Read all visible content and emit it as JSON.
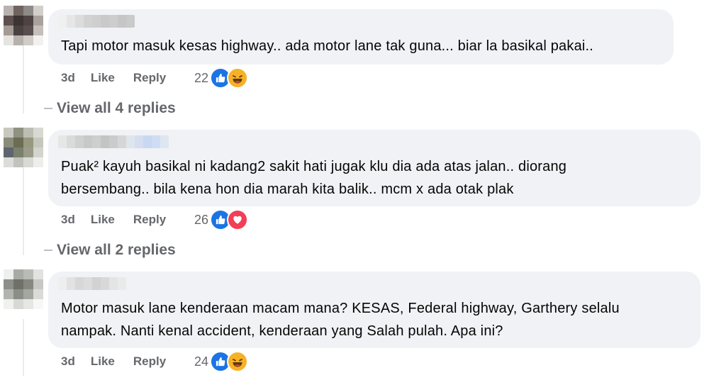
{
  "comments": [
    {
      "lines": [
        "Tapi motor masuk kesas highway.. ada motor lane tak guna... biar la basikal pakai.."
      ],
      "time": "3d",
      "like_label": "Like",
      "reply_label": "Reply",
      "reaction_count": "22",
      "reactions": [
        "like-icon",
        "haha-icon"
      ],
      "view_replies": "View all 4 replies"
    },
    {
      "lines": [
        "Puak² kayuh basikal ni kadang2 sakit hati jugak klu dia ada atas jalan.. diorang",
        "bersembang.. bila kena hon dia marah kita balik.. mcm x ada otak plak"
      ],
      "time": "3d",
      "like_label": "Like",
      "reply_label": "Reply",
      "reaction_count": "26",
      "reactions": [
        "like-icon",
        "love-icon"
      ],
      "view_replies": "View all 2 replies"
    },
    {
      "lines": [
        "Motor masuk lane kenderaan macam mana? KESAS, Federal highway, Garthery selalu",
        "nampak. Nanti kenal accident, kenderaan yang Salah pulah. Apa ini?"
      ],
      "time": "3d",
      "like_label": "Like",
      "reply_label": "Reply",
      "reaction_count": "24",
      "reactions": [
        "like-icon",
        "haha-icon"
      ]
    }
  ],
  "colors": {
    "bubble": "#f0f2f5",
    "secondary_text": "#65676b",
    "like_blue": "#1b74e4",
    "haha_yellow": "#f7b125",
    "love_red": "#f33e58"
  }
}
